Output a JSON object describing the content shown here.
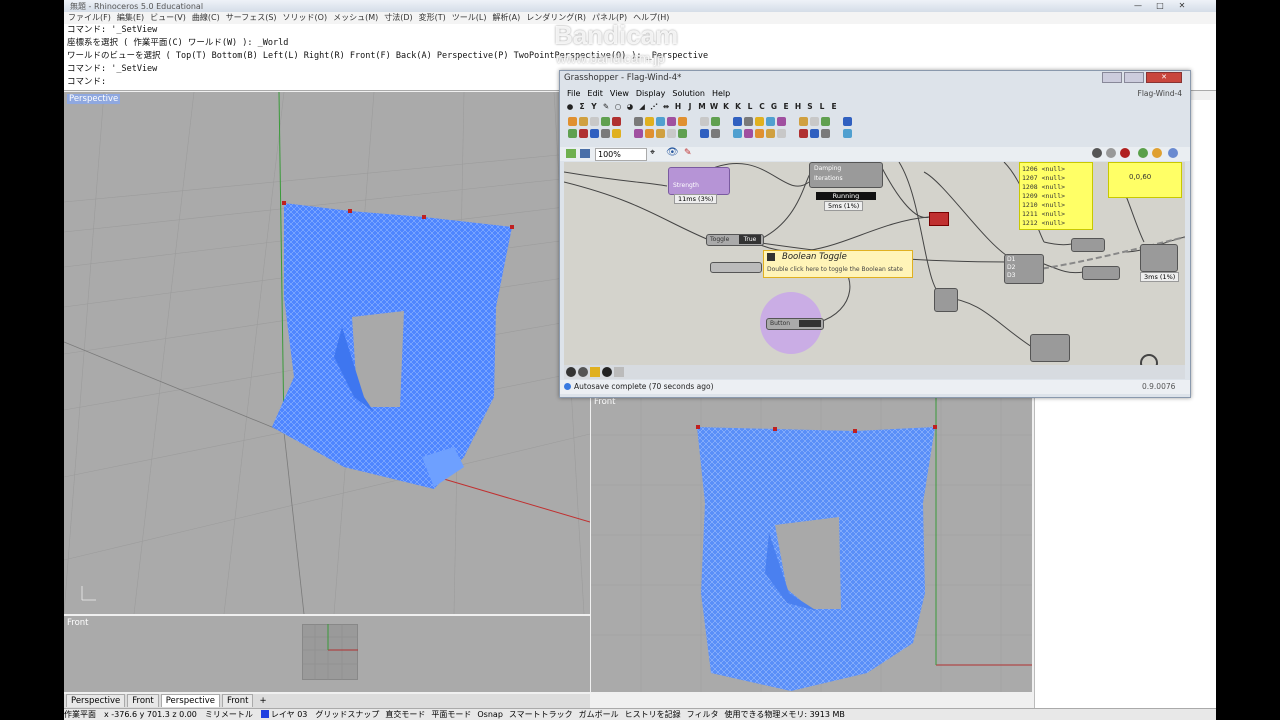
{
  "app": {
    "title": "無題 - Rhinoceros 5.0 Educational",
    "menu": [
      "ファイル(F)",
      "編集(E)",
      "ビュー(V)",
      "曲線(C)",
      "サーフェス(S)",
      "ソリッド(O)",
      "メッシュ(M)",
      "寸法(D)",
      "変形(T)",
      "ツール(L)",
      "解析(A)",
      "レンダリング(R)",
      "パネル(P)",
      "ヘルプ(H)"
    ],
    "win_min": "—",
    "win_max": "□",
    "win_close": "✕"
  },
  "command": {
    "lines": [
      "コマンド: '_SetView",
      "座標系を選択 ( 作業平面(C)  ワールド(W) ): _World",
      "ワールドのビューを選択 ( Top(T)  Bottom(B)  Left(L)  Right(R)  Front(F)  Back(A)  Perspective(P)  TwoPointPerspective(O) ): _Perspective",
      "コマンド: '_SetView",
      "コマンド:"
    ]
  },
  "watermark": {
    "name": "Bandicam",
    "url": "www.bandicam.jp"
  },
  "viewports": {
    "perspective_label": "Perspective",
    "front_small_label": "Front",
    "front_label": "Front"
  },
  "tabs": [
    "Perspective",
    "Front",
    "Perspective",
    "Front"
  ],
  "tabs_add": "+",
  "status": {
    "cplane": "作業平面",
    "coords": "x -376.6 y 701.3 z 0.00",
    "unit": "ミリメートル",
    "layer": "レイヤ 03",
    "items": [
      "グリッドスナップ",
      "直交モード",
      "平面モード",
      "Osnap",
      "スマートトラック",
      "ガムボール",
      "ヒストリを記録",
      "フィルタ",
      "使用できる物理メモリ: 3913 MB"
    ],
    "layer_color": "#2040e0"
  },
  "grasshopper": {
    "title": "Grasshopper - Flag-Wind-4*",
    "menu": [
      "File",
      "Edit",
      "View",
      "Display",
      "Solution",
      "Help"
    ],
    "doc_name": "Flag-Wind-4",
    "component_tabs": [
      "●",
      "Σ",
      "Y",
      "✎",
      "○",
      "◕",
      "◢",
      "⋰",
      "⇹",
      "H",
      "J",
      "M",
      "W",
      "K",
      "K",
      "L",
      "C",
      "G",
      "E",
      "H",
      "S",
      "L",
      "E"
    ],
    "zoom": "100%",
    "tooltip_title": "Boolean Toggle",
    "tooltip_desc": "Double click here to toggle the Boolean state",
    "toggle_label": "Toggle",
    "toggle_value": "True",
    "button_label": "Button",
    "strength_label": "Strength",
    "strength_time": "11ms (3%)",
    "damping_label": "Damping",
    "iterations_label": "Iterations",
    "running_label": "Running",
    "running_time": "5ms (1%)",
    "panel_items": [
      "1206 <null>",
      "1207 <null>",
      "1208 <null>",
      "1209 <null>",
      "1210 <null>",
      "1211 <null>",
      "1212 <null>"
    ],
    "panel2_value": "0,0,60",
    "d_inputs": [
      "D1",
      "D2",
      "D3"
    ],
    "mini_time": "3ms (1%)",
    "autosave": "Autosave complete (70 seconds ago)",
    "version": "0.9.0076"
  },
  "colors": {
    "mesh": "#4f86ff",
    "mesh_edge": "#b8d0ff",
    "canvas": "#d4d3cc"
  }
}
